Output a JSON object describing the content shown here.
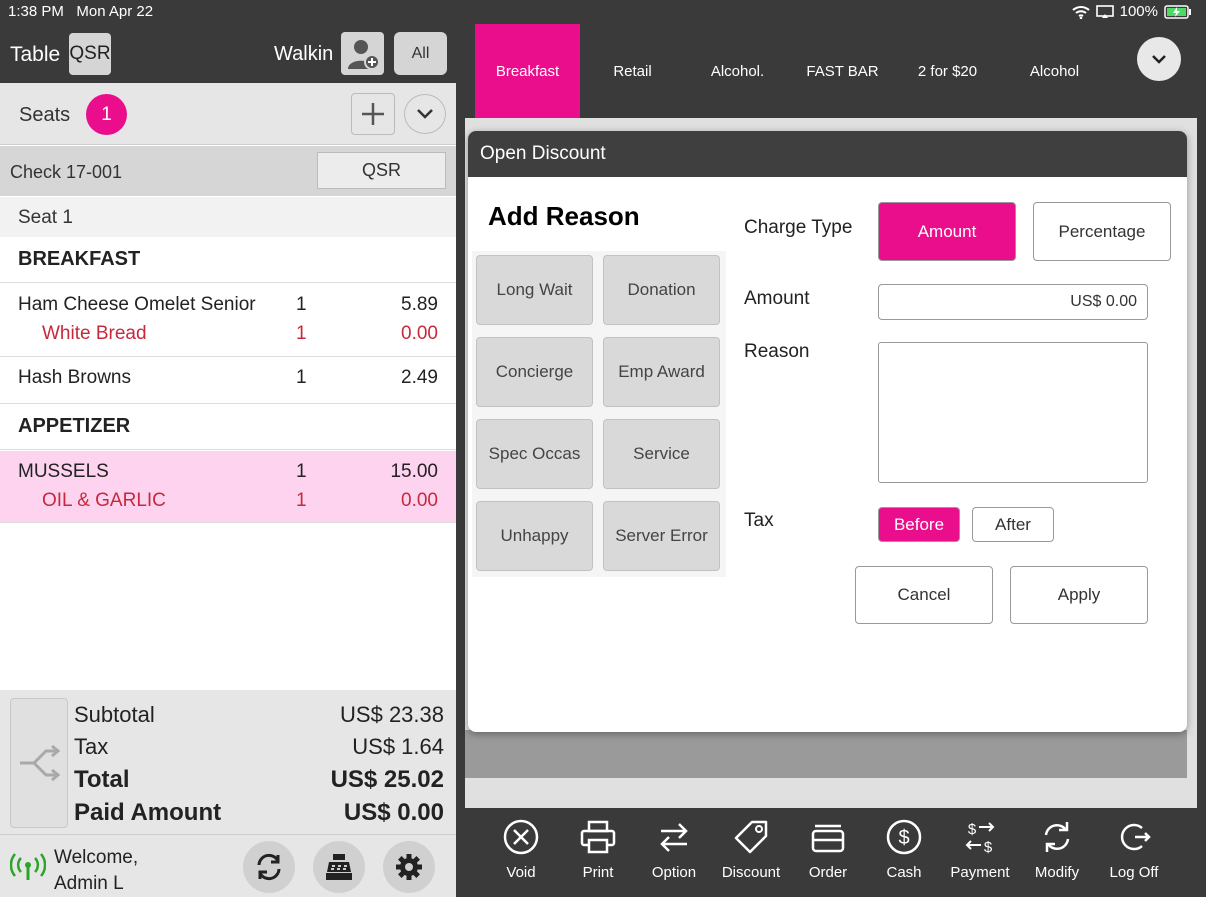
{
  "status": {
    "time": "1:38 PM",
    "date": "Mon Apr 22",
    "battery": "100%"
  },
  "header": {
    "table_label": "Table",
    "table_badge": "QSR",
    "walkin_label": "Walkin",
    "all_label": "All"
  },
  "seats": {
    "label": "Seats",
    "count": "1"
  },
  "check": {
    "label": "Check  17-001",
    "type": "QSR"
  },
  "seat_section": {
    "label": "Seat 1"
  },
  "categories": [
    {
      "name": "BREAKFAST"
    },
    {
      "name": "APPETIZER"
    }
  ],
  "items": [
    {
      "name": "Ham Cheese Omelet Senior",
      "qty": "1",
      "price": "5.89",
      "modifier": {
        "name": "White Bread",
        "qty": "1",
        "price": "0.00"
      }
    },
    {
      "name": "Hash Browns",
      "qty": "1",
      "price": "2.49"
    },
    {
      "name": "MUSSELS",
      "qty": "1",
      "price": "15.00",
      "modifier": {
        "name": "OIL & GARLIC",
        "qty": "1",
        "price": "0.00"
      }
    }
  ],
  "totals": {
    "subtotal_label": "Subtotal",
    "subtotal": "US$ 23.38",
    "tax_label": "Tax",
    "tax": "US$ 1.64",
    "total_label": "Total",
    "total": "US$ 25.02",
    "paid_label": "Paid Amount",
    "paid": "US$ 0.00"
  },
  "footer": {
    "welcome_line1": "Welcome,",
    "welcome_line2": "Admin L"
  },
  "tabs": [
    {
      "label": "Breakfast",
      "active": true
    },
    {
      "label": "Retail"
    },
    {
      "label": "Alcohol."
    },
    {
      "label": "FAST BAR"
    },
    {
      "label": "2 for $20"
    },
    {
      "label": "Alcohol"
    }
  ],
  "dialog": {
    "title": "Open Discount",
    "add_reason": "Add Reason",
    "reasons": [
      "Long Wait",
      "Donation",
      "Concierge",
      "Emp Award",
      "Spec Occas",
      "Service",
      "Unhappy",
      "Server Error"
    ],
    "charge_type_label": "Charge Type",
    "charge_amount": "Amount",
    "charge_percentage": "Percentage",
    "amount_label": "Amount",
    "amount_value": "US$ 0.00",
    "reason_label": "Reason",
    "reason_value": "",
    "tax_label": "Tax",
    "tax_before": "Before",
    "tax_after": "After",
    "cancel": "Cancel",
    "apply": "Apply"
  },
  "toolbar": [
    "Void",
    "Print",
    "Option",
    "Discount",
    "Order",
    "Cash",
    "Payment",
    "Modify",
    "Log Off"
  ],
  "colors": {
    "accent": "#ea0d8c",
    "modifier": "#c8283c",
    "dark": "#3a3a3a",
    "selected_row": "#fdd3f0",
    "wifi_green": "#2aa52a"
  }
}
